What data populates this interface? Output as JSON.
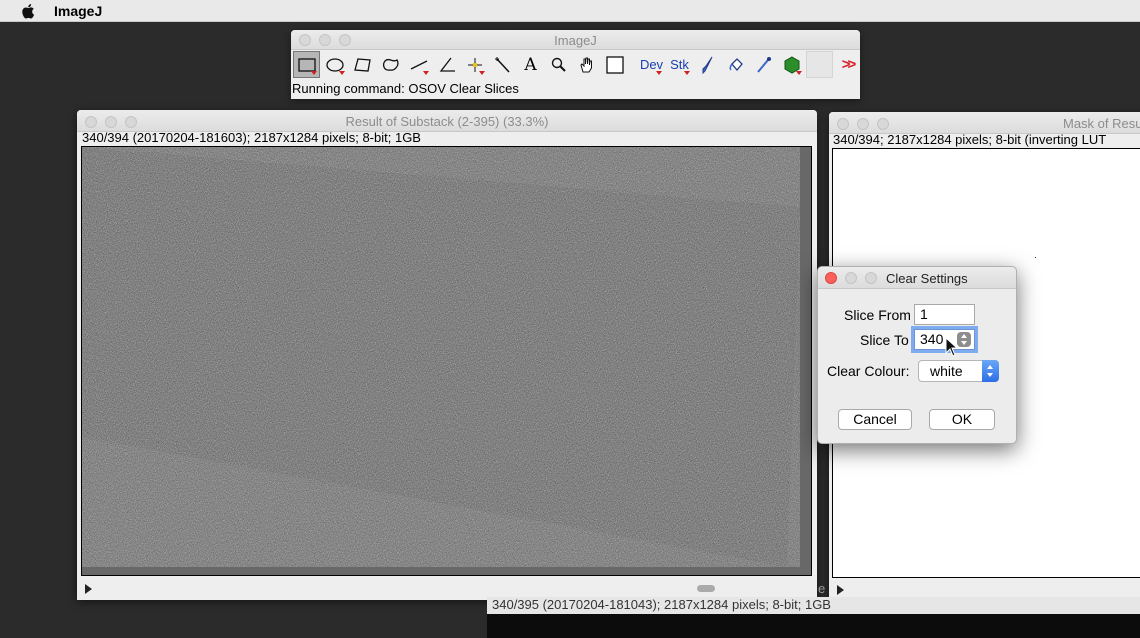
{
  "menubar": {
    "app_name": "ImageJ",
    "apple_icon": "apple-logo-icon"
  },
  "imagej_window": {
    "title": "ImageJ",
    "status": "Running command: OSOV Clear Slices",
    "tools": [
      {
        "name": "rectangle-tool-icon",
        "selected": true
      },
      {
        "name": "oval-tool-icon"
      },
      {
        "name": "polygon-tool-icon"
      },
      {
        "name": "freehand-tool-icon"
      },
      {
        "name": "line-tool-icon"
      },
      {
        "name": "angle-tool-icon"
      },
      {
        "name": "point-tool-icon"
      },
      {
        "name": "wand-tool-icon"
      },
      {
        "name": "text-tool-icon",
        "label": "A"
      },
      {
        "name": "magnifier-tool-icon"
      },
      {
        "name": "hand-tool-icon"
      },
      {
        "name": "color-picker-tool-icon"
      },
      {
        "name": "developer-menu-icon",
        "label": "Dev"
      },
      {
        "name": "stack-menu-icon",
        "label": "Stk"
      },
      {
        "name": "brush-tool-icon"
      },
      {
        "name": "flood-fill-tool-icon"
      },
      {
        "name": "pipette-tool-icon"
      },
      {
        "name": "3d-viewer-icon"
      },
      {
        "name": "blank-tool-slot"
      },
      {
        "name": "more-tools-icon",
        "label": ">>"
      }
    ]
  },
  "substack_window": {
    "title": "Result of Substack (2-395) (33.3%)",
    "info": "340/394 (20170204-181603); 2187x1284 pixels; 8-bit; 1GB"
  },
  "mask_window": {
    "title": "Mask of Resu",
    "info": "340/394; 2187x1284 pixels; 8-bit (inverting LUT"
  },
  "background_window": {
    "info": "340/395 (20170204-181043); 2187x1284 pixels; 8-bit; 1GB",
    "stray_char": "e"
  },
  "dialog": {
    "title": "Clear Settings",
    "slice_from_label": "Slice From",
    "slice_from_value": "1",
    "slice_to_label": "Slice To",
    "slice_to_value": "340",
    "colour_label": "Clear Colour:",
    "colour_value": "white",
    "cancel_label": "Cancel",
    "ok_label": "OK"
  }
}
